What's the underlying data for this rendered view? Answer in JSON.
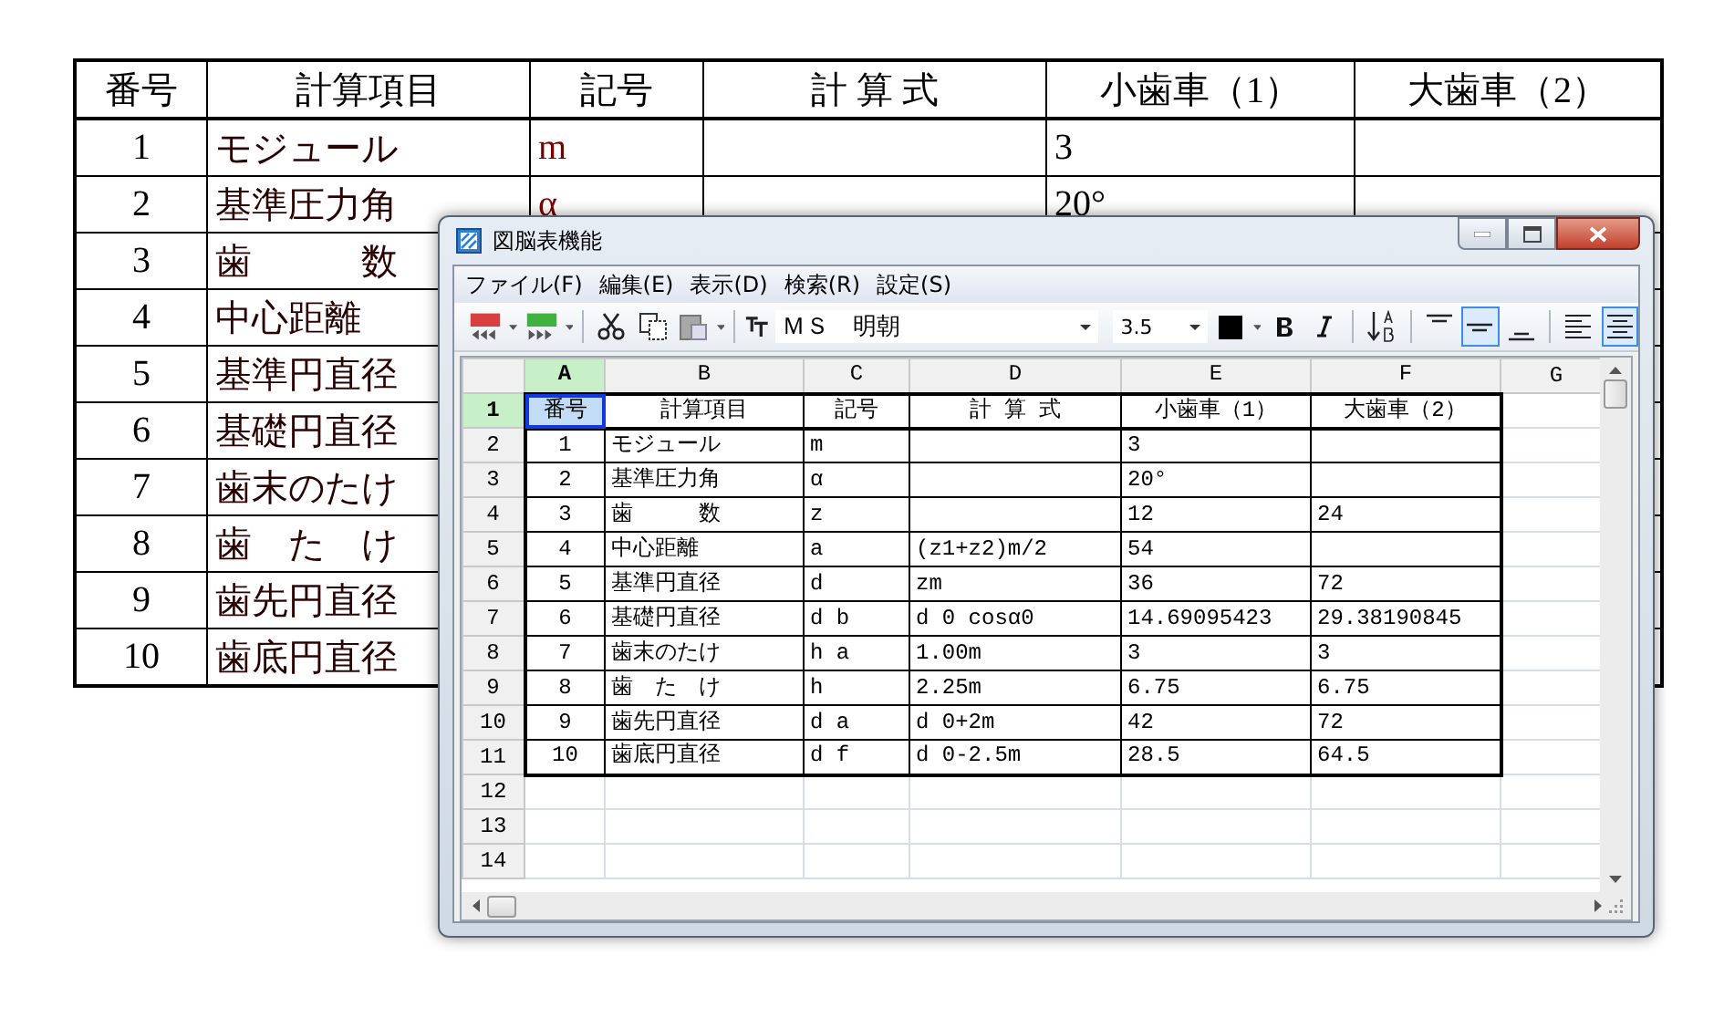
{
  "document_table": {
    "columns": [
      "番号",
      "計算項目",
      "記号",
      "計 算 式",
      "小歯車（1）",
      "大歯車（2）"
    ],
    "rows": [
      {
        "no": "1",
        "item": "モジュール",
        "symbol": "m",
        "pinion": "3"
      },
      {
        "no": "2",
        "item": "基準圧力角",
        "symbol": "α",
        "pinion": "20°"
      },
      {
        "no": "3",
        "item": "歯　　　数"
      },
      {
        "no": "4",
        "item": "中心距離"
      },
      {
        "no": "5",
        "item": "基準円直径"
      },
      {
        "no": "6",
        "item": "基礎円直径"
      },
      {
        "no": "7",
        "item": "歯末のたけ"
      },
      {
        "no": "8",
        "item": "歯　た　け"
      },
      {
        "no": "9",
        "item": "歯先円直径"
      },
      {
        "no": "10",
        "item": "歯底円直径"
      }
    ]
  },
  "window": {
    "title": "図脳表機能",
    "menu": [
      "ファイル(F)",
      "編集(E)",
      "表示(D)",
      "検索(R)",
      "設定(S)"
    ],
    "toolbar": {
      "font": "ＭＳ　明朝",
      "size": "3.5",
      "vertical_align": [
        {
          "selected": false
        },
        {
          "selected": true
        },
        {
          "selected": false
        }
      ],
      "horizontal_align": [
        {
          "selected": false
        },
        {
          "selected": true
        }
      ]
    },
    "sheet": {
      "columns": [
        {
          "label": "A",
          "selected": true
        },
        {
          "label": "B",
          "selected": false
        },
        {
          "label": "C",
          "selected": false
        },
        {
          "label": "D",
          "selected": false
        },
        {
          "label": "E",
          "selected": false
        },
        {
          "label": "F",
          "selected": false
        },
        {
          "label": "G",
          "selected": false
        }
      ],
      "rows": [
        {
          "label": "1",
          "selected": true,
          "no": "番号",
          "item": "計算項目",
          "symbol": "記号",
          "formula": "計 算 式",
          "pinion": "小歯車（1）",
          "gear": "大歯車（2）"
        },
        {
          "label": "2",
          "selected": false,
          "no": "1",
          "item": "モジュール",
          "symbol": "m",
          "pinion": "3"
        },
        {
          "label": "3",
          "selected": false,
          "no": "2",
          "item": "基準圧力角",
          "symbol": "α",
          "pinion": "20°"
        },
        {
          "label": "4",
          "selected": false,
          "no": "3",
          "item": "歯　　　数",
          "symbol": "z",
          "pinion": "12",
          "gear": "24"
        },
        {
          "label": "5",
          "selected": false,
          "no": "4",
          "item": "中心距離",
          "symbol": "a",
          "formula": "(z1+z2)m/2",
          "pinion": "54"
        },
        {
          "label": "6",
          "selected": false,
          "no": "5",
          "item": "基準円直径",
          "symbol": "d",
          "formula": "zm",
          "pinion": "36",
          "gear": "72"
        },
        {
          "label": "7",
          "selected": false,
          "no": "6",
          "item": "基礎円直径",
          "symbol": "d b",
          "formula": "d 0 cosα0",
          "pinion": "14.69095423",
          "gear": "29.38190845"
        },
        {
          "label": "8",
          "selected": false,
          "no": "7",
          "item": "歯末のたけ",
          "symbol": "h a",
          "formula": "1.00m",
          "pinion": "3",
          "gear": "3"
        },
        {
          "label": "9",
          "selected": false,
          "no": "8",
          "item": "歯　た　け",
          "symbol": "h",
          "formula": "2.25m",
          "pinion": "6.75",
          "gear": "6.75"
        },
        {
          "label": "10",
          "selected": false,
          "no": "9",
          "item": "歯先円直径",
          "symbol": "d a",
          "formula": "d 0+2m",
          "pinion": "42",
          "gear": "72"
        },
        {
          "label": "11",
          "selected": false,
          "no": "10",
          "item": "歯底円直径",
          "symbol": "d f",
          "formula": "d 0-2.5m",
          "pinion": "28.5",
          "gear": "64.5"
        },
        {
          "label": "12",
          "selected": false
        },
        {
          "label": "13",
          "selected": false
        },
        {
          "label": "14",
          "selected": false
        }
      ]
    }
  }
}
